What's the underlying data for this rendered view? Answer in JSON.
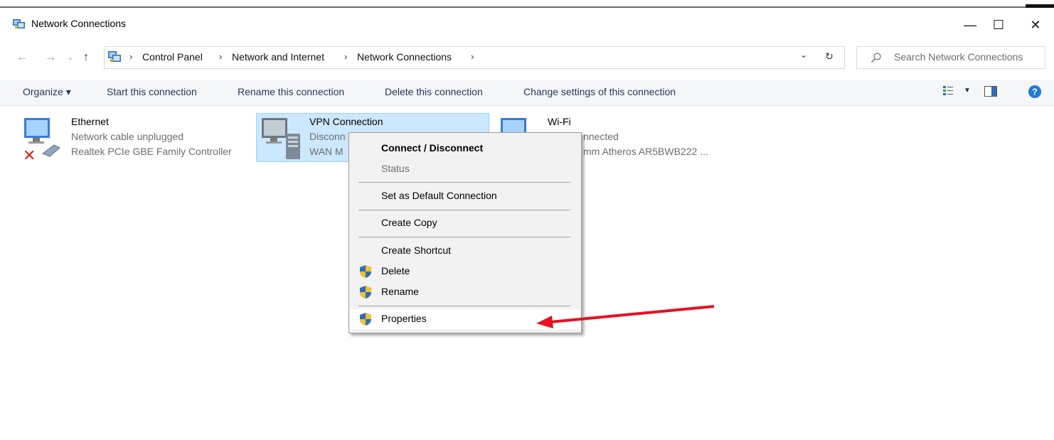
{
  "window": {
    "title": "Network Connections",
    "controls": {
      "minimize": "—",
      "maximize": "☐",
      "close": "✕"
    }
  },
  "address_bar": {
    "breadcrumbs": [
      "Control Panel",
      "Network and Internet",
      "Network Connections"
    ],
    "search_placeholder": "Search Network Connections"
  },
  "command_bar": {
    "organize": "Organize ▾",
    "items": [
      "Start this connection",
      "Rename this connection",
      "Delete this connection",
      "Change settings of this connection"
    ]
  },
  "connections": [
    {
      "name": "Ethernet",
      "status": "Network cable unplugged",
      "device": "Realtek PCIe GBE Family Controller",
      "icon": "ethernet-adapter-icon"
    },
    {
      "name": "VPN Connection",
      "status": "Disconn",
      "device": "WAN M",
      "icon": "vpn-adapter-icon",
      "selected": true
    },
    {
      "name": "Wi-Fi",
      "status": "nnected",
      "device": "mm Atheros AR5BWB222 ...",
      "icon": "wifi-adapter-icon"
    }
  ],
  "context_menu": {
    "items": [
      {
        "label": "Connect / Disconnect",
        "bold": true
      },
      {
        "label": "Status",
        "disabled": true
      },
      {
        "label": "Set as Default Connection"
      },
      {
        "label": "Create Copy"
      },
      {
        "label": "Create Shortcut"
      },
      {
        "label": "Delete",
        "shield": true
      },
      {
        "label": "Rename",
        "shield": true
      },
      {
        "label": "Properties",
        "shield": true,
        "highlighted": true
      }
    ]
  },
  "annotation": {
    "type": "red-arrow",
    "target": "Properties",
    "color": "#e81123"
  },
  "colors": {
    "selection_bg": "#cce8ff",
    "selection_border": "#99d1ff",
    "link_text": "#1e395b",
    "help_blue": "#1e7ad6"
  }
}
